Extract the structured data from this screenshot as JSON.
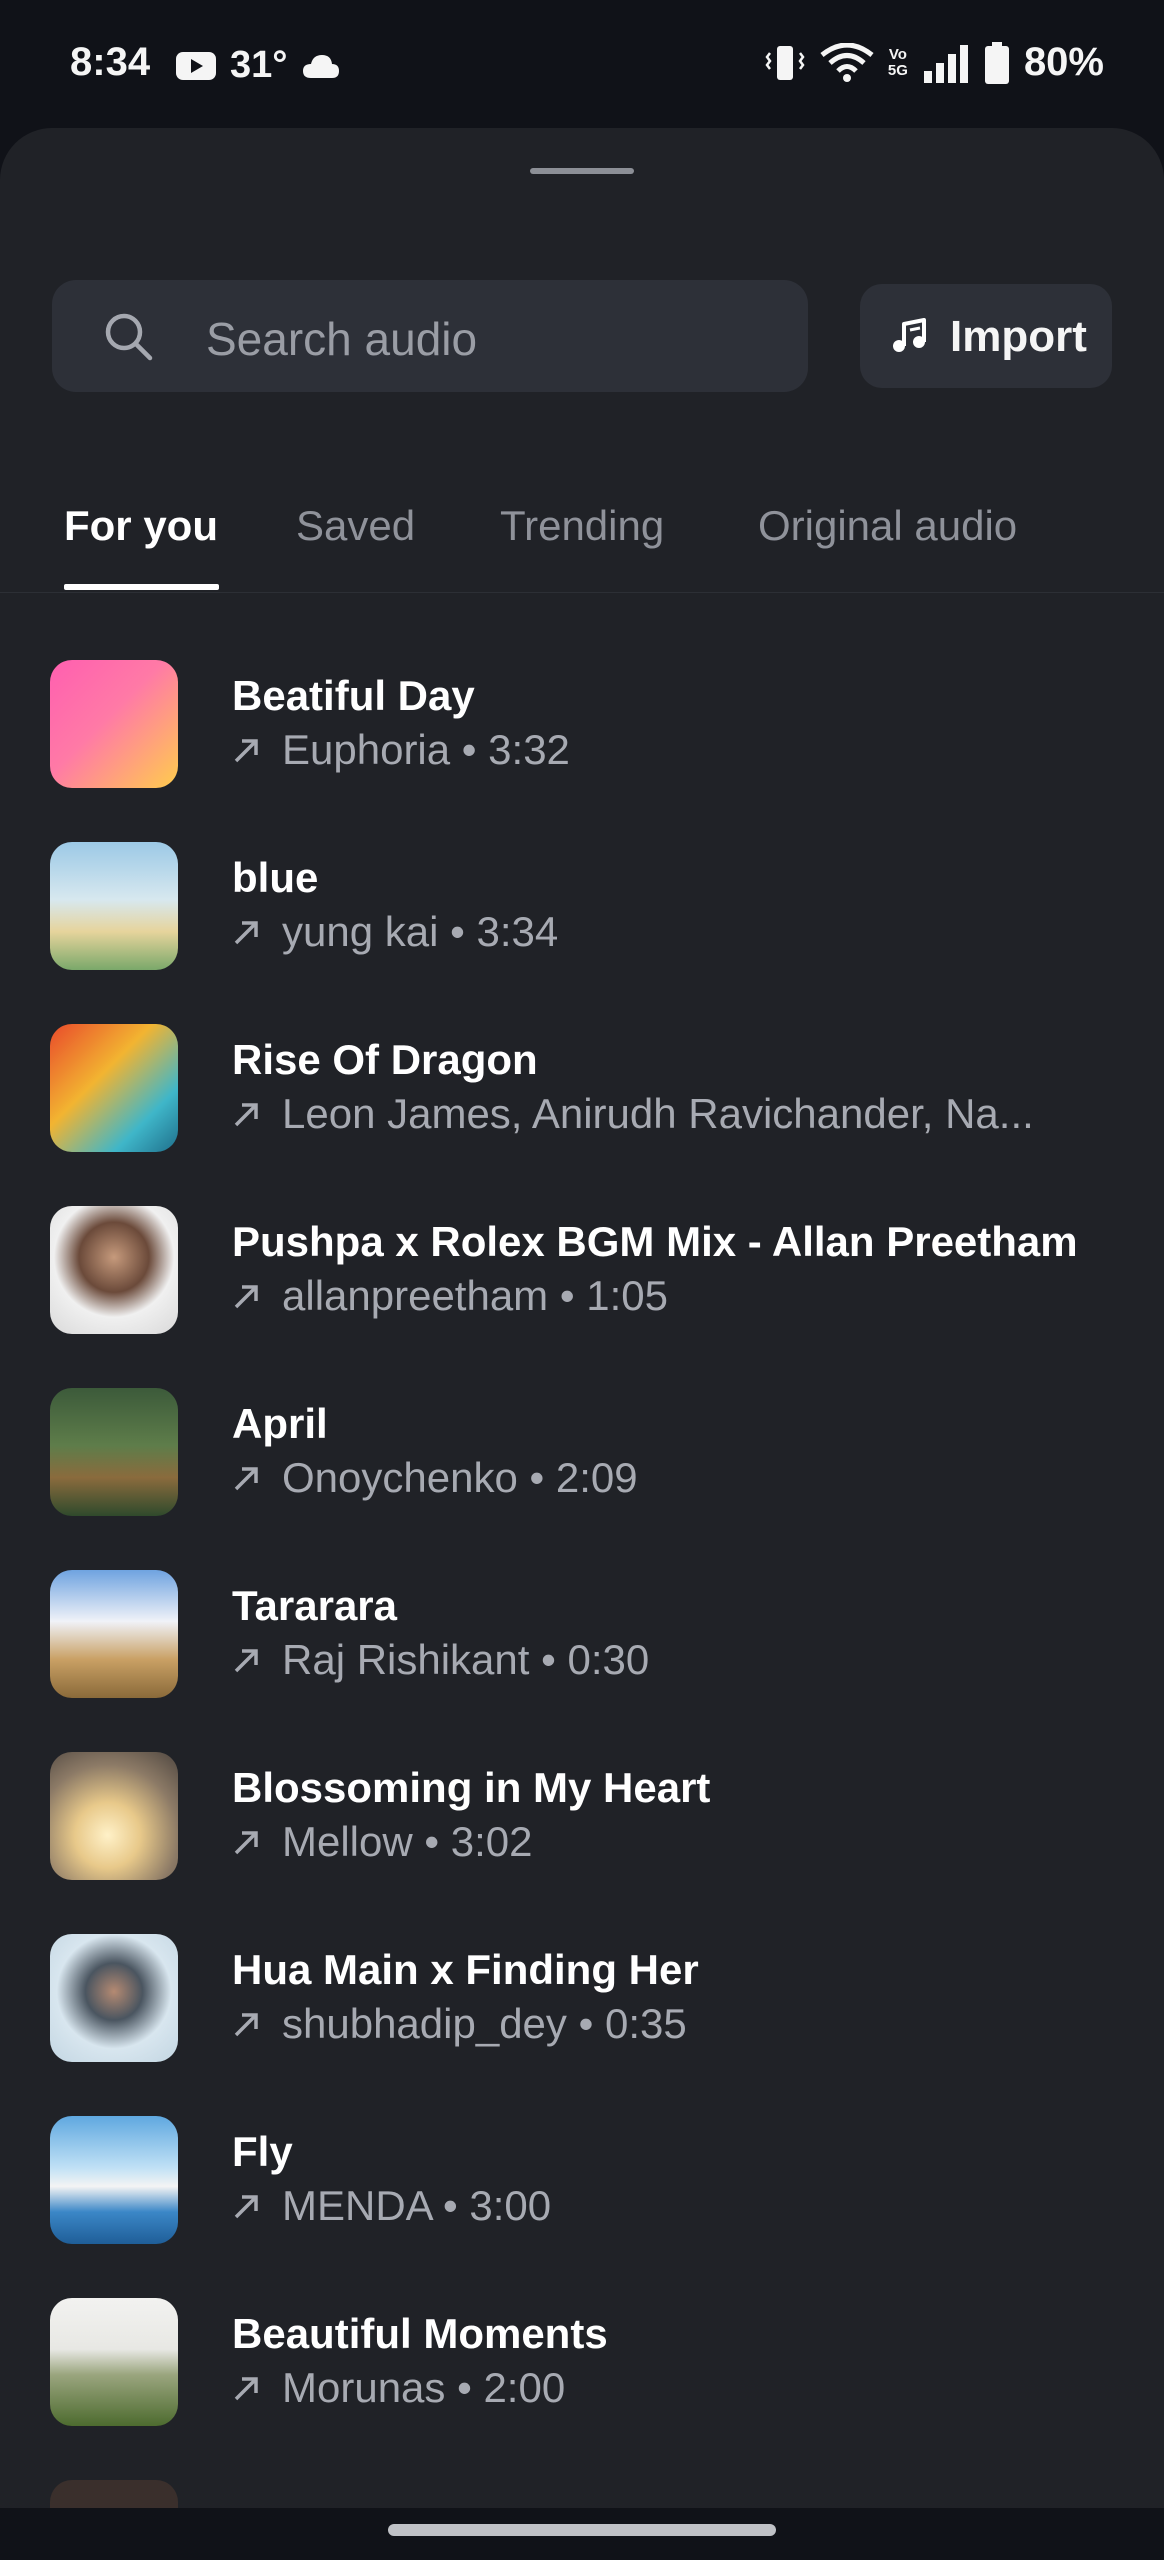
{
  "status_bar": {
    "time": "8:34",
    "temperature": "31°",
    "battery": "80%",
    "volte": "Vo\n5G"
  },
  "search": {
    "placeholder": "Search audio"
  },
  "import": {
    "label": "Import"
  },
  "tabs": [
    "For you",
    "Saved",
    "Trending",
    "Original audio"
  ],
  "active_tab": "For you",
  "tracks": [
    {
      "title": "Beatiful Day",
      "meta": "Euphoria • 3:32"
    },
    {
      "title": "blue",
      "meta": "yung kai • 3:34"
    },
    {
      "title": "Rise Of Dragon",
      "meta": "Leon James, Anirudh Ravichander, Na..."
    },
    {
      "title": "Pushpa x Rolex BGM Mix - Allan Preetham",
      "meta": "allanpreetham • 1:05"
    },
    {
      "title": "April",
      "meta": "Onoychenko • 2:09"
    },
    {
      "title": "Tararara",
      "meta": "Raj Rishikant • 0:30"
    },
    {
      "title": "Blossoming in My Heart",
      "meta": "Mellow • 3:02"
    },
    {
      "title": "Hua Main x Finding Her",
      "meta": "shubhadip_dey • 0:35"
    },
    {
      "title": "Fly",
      "meta": "MENDA • 3:00"
    },
    {
      "title": "Beautiful Moments",
      "meta": "Morunas • 2:00"
    }
  ],
  "colors": {
    "background": "#101218",
    "sheet": "#202227",
    "input": "#2d3038",
    "text_primary": "#ffffff",
    "text_secondary": "#a7aab2"
  }
}
